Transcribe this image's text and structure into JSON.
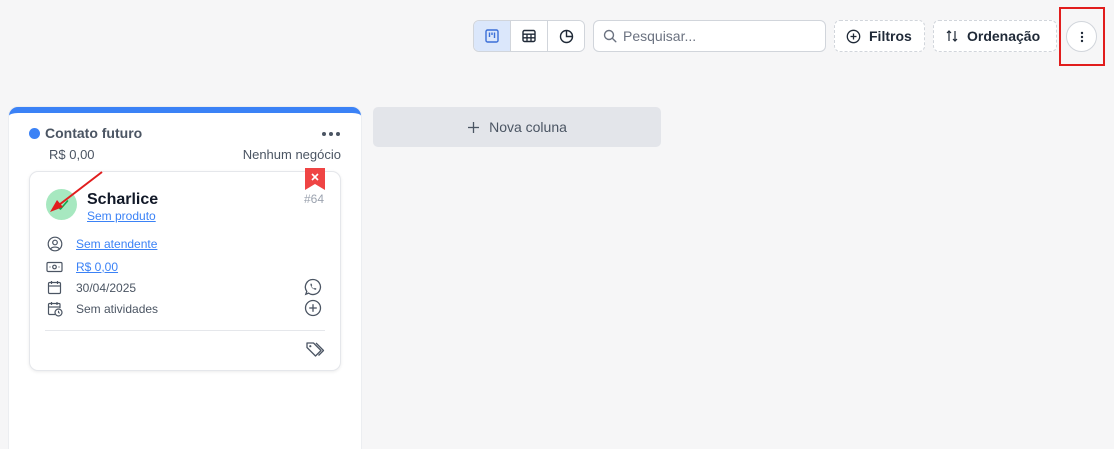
{
  "toolbar": {
    "views": [
      {
        "icon": "kanban-icon",
        "active": true
      },
      {
        "icon": "table-icon",
        "active": false
      },
      {
        "icon": "pie-chart-icon",
        "active": false
      }
    ],
    "search_placeholder": "Pesquisar...",
    "filters_label": "Filtros",
    "sort_label": "Ordenação",
    "more_icon": "more-vertical-icon",
    "highlight_color": "#e11d1d"
  },
  "column": {
    "title": "Contato futuro",
    "color": "#3b82f6",
    "value": "R$ 0,00",
    "count": "Nenhum negócio",
    "card": {
      "name": "Scharlice",
      "product": "Sem produto",
      "number": "#64",
      "attendant": "Sem atendente",
      "amount": "R$ 0,00",
      "date": "30/04/2025",
      "activities": "Sem atividades",
      "status_icon": "check-icon",
      "status_color": "#a7e8c0"
    }
  },
  "new_column_label": "Nova coluna"
}
